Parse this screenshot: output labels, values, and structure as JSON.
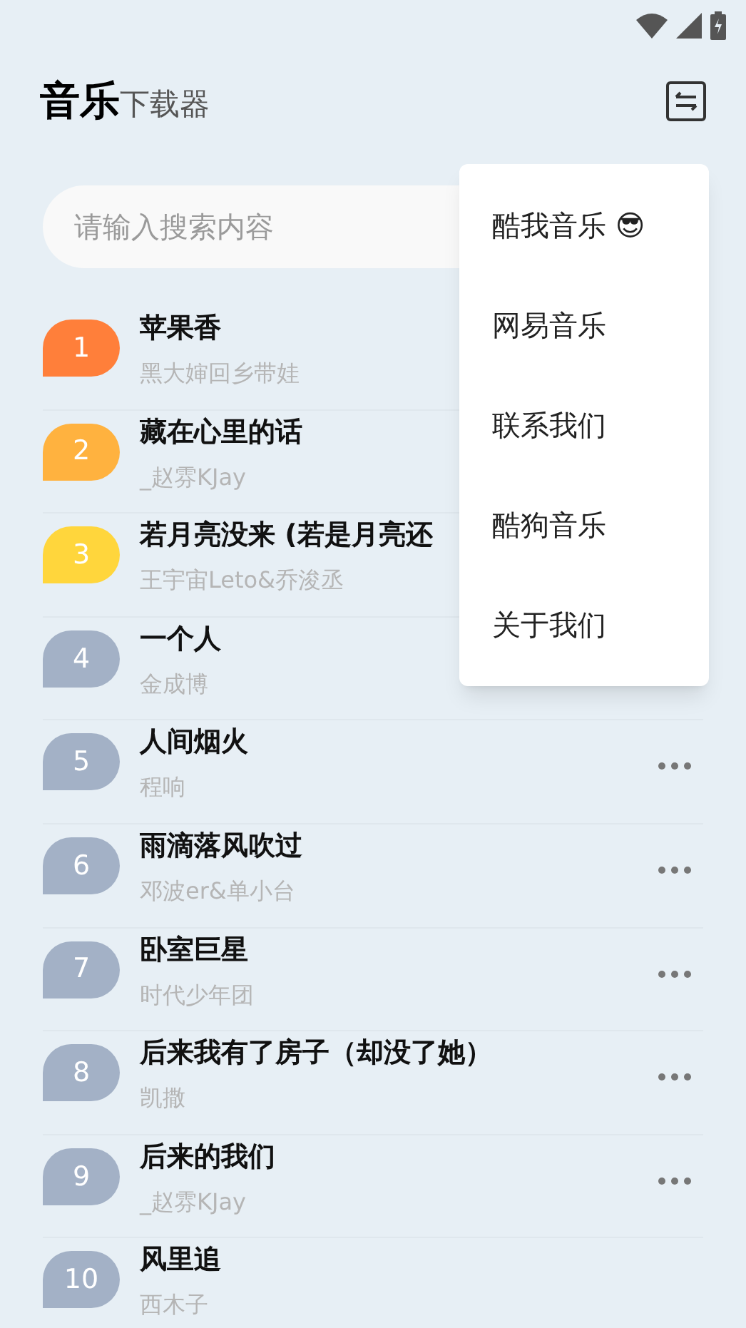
{
  "header": {
    "title": "音乐",
    "subtitle": "下载器"
  },
  "search": {
    "placeholder": "请输入搜索内容"
  },
  "songs": [
    {
      "rank": "1",
      "title": "苹果香",
      "artist": "黑大婶回乡带娃",
      "color": "#ff7f3a"
    },
    {
      "rank": "2",
      "title": "藏在心里的话",
      "artist": "_赵雰KJay",
      "color": "#ffb23f"
    },
    {
      "rank": "3",
      "title": "若月亮没来 (若是月亮还",
      "artist": "王宇宙Leto&乔浚丞",
      "color": "#ffd63c"
    },
    {
      "rank": "4",
      "title": "一个人",
      "artist": "金成博",
      "color": "#a3b1c6"
    },
    {
      "rank": "5",
      "title": "人间烟火",
      "artist": "程响",
      "color": "#a3b1c6",
      "menu_button": true
    },
    {
      "rank": "6",
      "title": "雨滴落风吹过",
      "artist": "邓波er&单小台",
      "color": "#a3b1c6",
      "menu_button": true
    },
    {
      "rank": "7",
      "title": "卧室巨星",
      "artist": "时代少年团",
      "color": "#a3b1c6",
      "menu_button": true
    },
    {
      "rank": "8",
      "title": "后来我有了房子（却没了她）",
      "artist": "凯撒",
      "color": "#a3b1c6",
      "menu_button": true
    },
    {
      "rank": "9",
      "title": "后来的我们",
      "artist": "_赵雰KJay",
      "color": "#a3b1c6",
      "menu_button": true
    },
    {
      "rank": "10",
      "title": "风里追",
      "artist": "西木子",
      "color": "#a3b1c6",
      "menu_button": false
    }
  ],
  "menu": {
    "items": [
      {
        "label": "酷我音乐 😎"
      },
      {
        "label": "网易音乐"
      },
      {
        "label": "联系我们"
      },
      {
        "label": "酷狗音乐"
      },
      {
        "label": "关于我们"
      }
    ]
  }
}
